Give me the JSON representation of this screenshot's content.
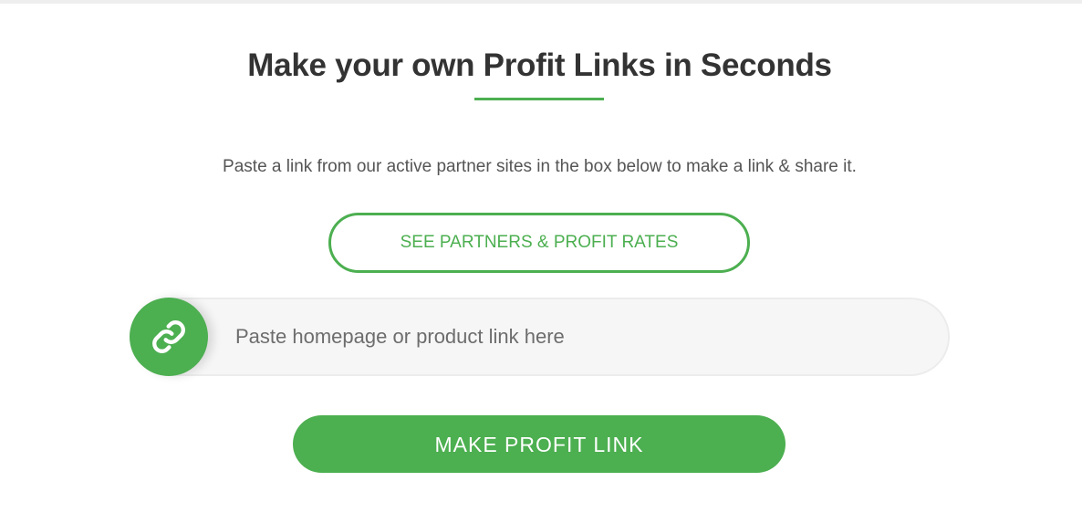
{
  "header": {
    "title": "Make your own Profit Links in Seconds",
    "subtitle": "Paste a link from our active partner sites in the box below to make a link & share it."
  },
  "partners_button": {
    "label": "SEE PARTNERS & PROFIT RATES"
  },
  "link_input": {
    "value": "",
    "placeholder": "Paste homepage or product link here",
    "icon": "link-icon"
  },
  "submit_button": {
    "label": "MAKE PROFIT LINK"
  },
  "colors": {
    "accent": "#4caf50",
    "heading": "#333333",
    "body_text": "#555555",
    "input_bg": "#f6f6f6"
  }
}
